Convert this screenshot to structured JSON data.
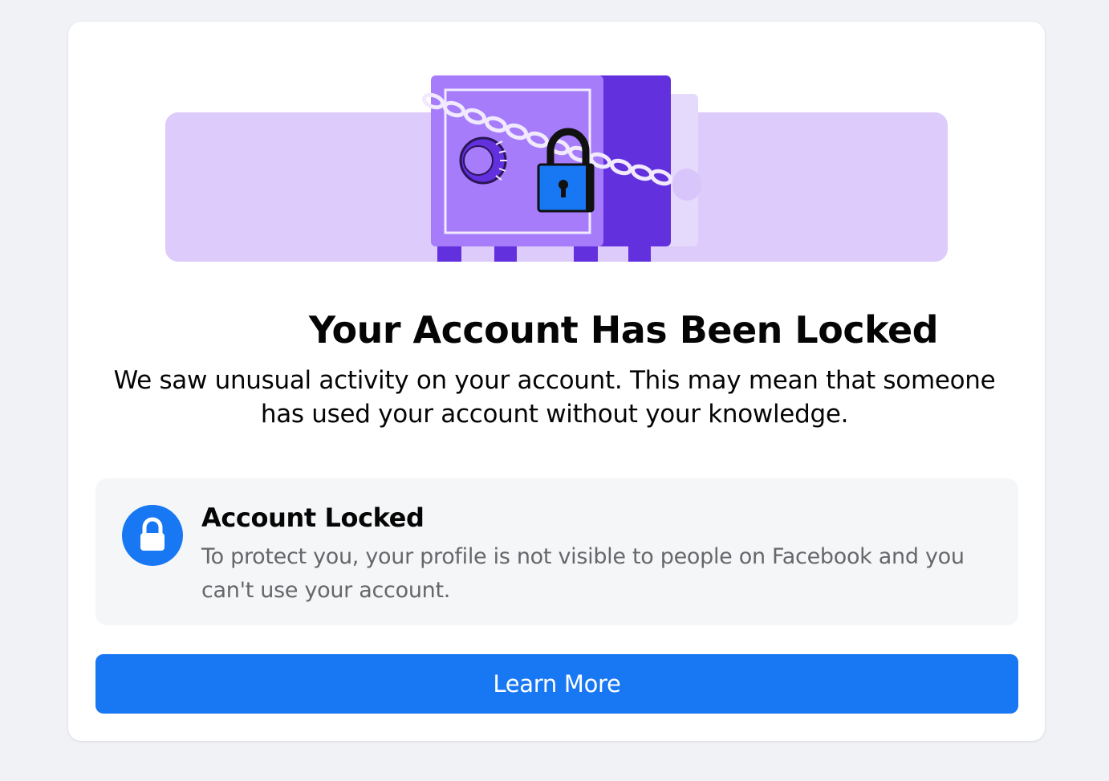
{
  "heading": {
    "title": "Your Account Has Been Locked",
    "description": "We saw unusual activity on your account. This may mean that someone has used your account without your knowledge."
  },
  "notice": {
    "icon": "lock-icon",
    "title": "Account Locked",
    "text": "To protect you, your profile is not visible to people on Facebook and you can't use your account."
  },
  "actions": {
    "learn_more_label": "Learn More"
  },
  "illustration": {
    "icon": "locked-safe-illustration"
  },
  "colors": {
    "page_background": "#f0f2f5",
    "card_background": "#ffffff",
    "accent_blue": "#1877f2",
    "illustration_lavender": "#dccbfb",
    "safe_purple": "#a67cfb",
    "safe_dark_purple": "#6330dd",
    "notice_background": "#f5f6f7",
    "secondary_text": "#65676b"
  }
}
